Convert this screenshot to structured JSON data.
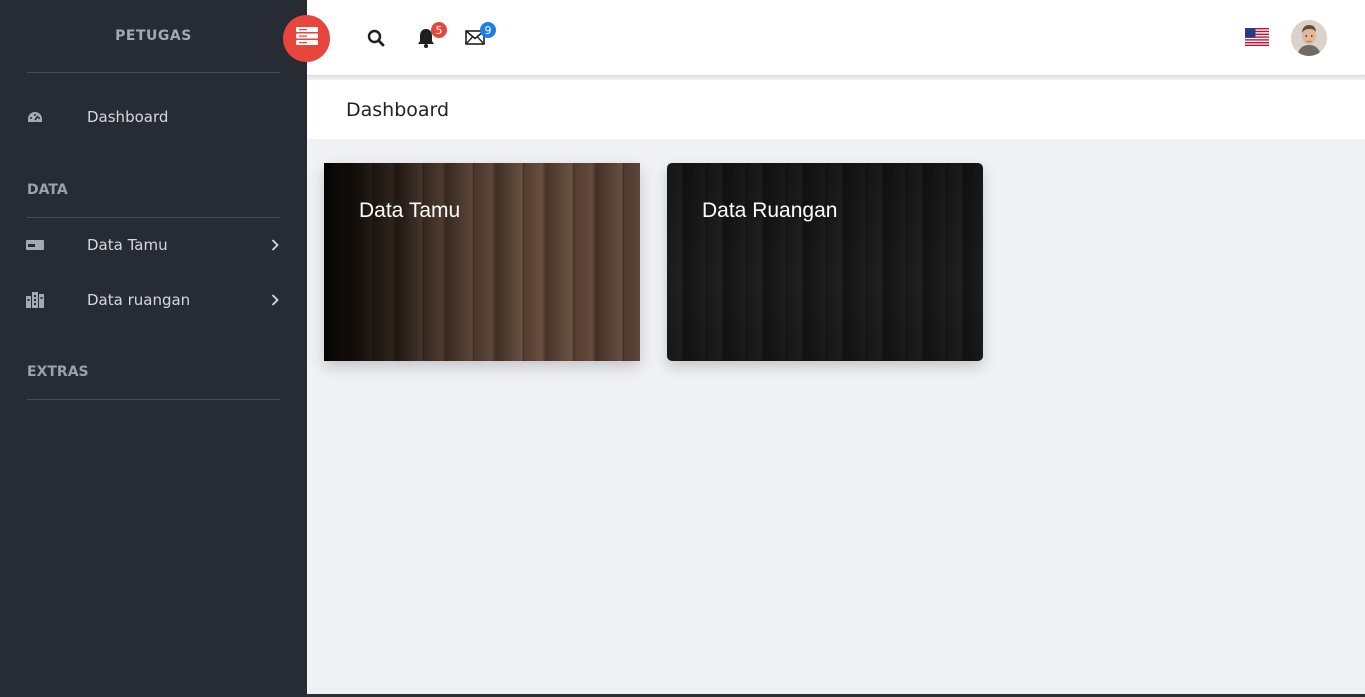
{
  "sidebar": {
    "brand": "PETUGAS",
    "items": [
      {
        "label": "Dashboard",
        "icon": "dashboard-gauge-icon"
      },
      {
        "label": "Data Tamu",
        "icon": "id-card-icon"
      },
      {
        "label": "Data ruangan",
        "icon": "building-icon"
      }
    ],
    "sections": [
      "DATA",
      "EXTRAS"
    ]
  },
  "topbar": {
    "menu_toggle_icon": "server-menu-icon",
    "search_icon": "search-icon",
    "notifications": {
      "icon": "bell-icon",
      "count": "5",
      "color": "#e8453c"
    },
    "messages": {
      "icon": "envelope-icon",
      "count": "9",
      "color": "#1a7fe6"
    },
    "language_flag": "us-flag-icon",
    "avatar": "user-avatar"
  },
  "page": {
    "title": "Dashboard"
  },
  "cards": [
    {
      "title": "Data Tamu"
    },
    {
      "title": "Data Ruangan"
    }
  ],
  "colors": {
    "sidebar_bg": "#272b33",
    "accent_red": "#e8453c",
    "badge_blue": "#1a7fe6",
    "content_bg": "#f0f1f5"
  }
}
